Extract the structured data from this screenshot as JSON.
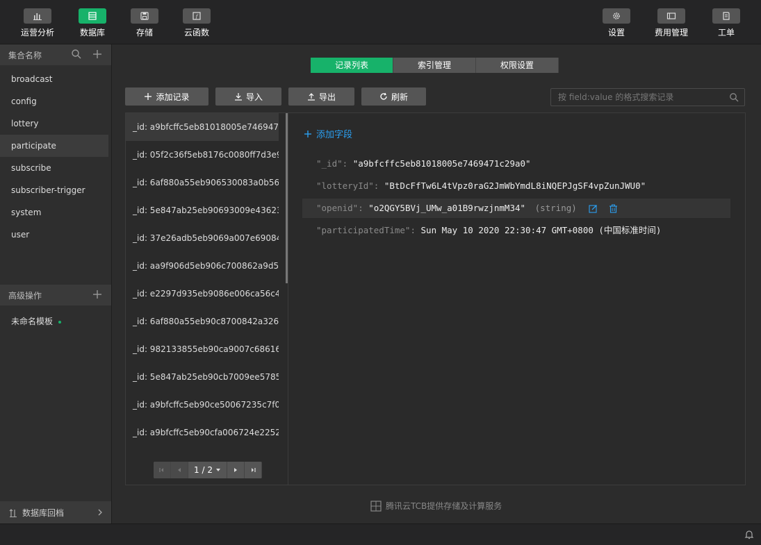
{
  "topbar": {
    "left": [
      {
        "label": "运营分析",
        "icon": "bar-chart-icon"
      },
      {
        "label": "数据库",
        "icon": "database-icon"
      },
      {
        "label": "存储",
        "icon": "storage-icon"
      },
      {
        "label": "云函数",
        "icon": "cloud-function-icon"
      }
    ],
    "right": [
      {
        "label": "设置",
        "icon": "gear-icon"
      },
      {
        "label": "费用管理",
        "icon": "billing-icon"
      },
      {
        "label": "工单",
        "icon": "ticket-icon"
      }
    ]
  },
  "sidebar": {
    "header": "集合名称",
    "collections": [
      "broadcast",
      "config",
      "lottery",
      "participate",
      "subscribe",
      "subscriber-trigger",
      "system",
      "user"
    ],
    "advanced_header": "高级操作",
    "template_item": "未命名模板",
    "backfile": "数据库回档"
  },
  "tabs": [
    "记录列表",
    "索引管理",
    "权限设置"
  ],
  "toolbar": {
    "add": "添加记录",
    "import": "导入",
    "export": "导出",
    "refresh": "刷新"
  },
  "search": {
    "placeholder": "按 field:value 的格式搜索记录"
  },
  "records": [
    "_id: a9bfcffc5eb81018005e746947...",
    "_id: 05f2c36f5eb8176c0080ff7d3e9...",
    "_id: 6af880a55eb906530083a0b56f...",
    "_id: 5e847ab25eb90693009e43623...",
    "_id: 37e26adb5eb9069a007e69084...",
    "_id: aa9f906d5eb906c700862a9d5...",
    "_id: e2297d935eb9086e006ca56c4...",
    "_id: 6af880a55eb90c8700842a3268...",
    "_id: 982133855eb90ca9007c68616...",
    "_id: 5e847ab25eb90cb7009ee5785...",
    "_id: a9bfcffc5eb90ce50067235c7f0...",
    "_id: a9bfcffc5eb90cfa006724e2252..."
  ],
  "pager": {
    "text": "1 / 2"
  },
  "detail": {
    "add_field": "添加字段",
    "fields": [
      {
        "key": "\"_id\":",
        "value": "\"a9bfcffc5eb81018005e7469471c29a0\""
      },
      {
        "key": "\"lotteryId\":",
        "value": "\"BtDcFfTw6L4tVpz0raG2JmWbYmdL8iNQEPJgSF4vpZunJWU0\""
      },
      {
        "key": "\"openid\":",
        "value": "\"o2QGY5BVj_UMw_a01B9rwzjnmM34\"",
        "type": "(string)"
      },
      {
        "key": "\"participatedTime\":",
        "value": "Sun May 10 2020 22:30:47 GMT+0800 (中国标准时间)"
      }
    ]
  },
  "footer": "腾讯云TCB提供存储及计算服务",
  "colors": {
    "accent": "#17b26a",
    "link": "#2b9ff0"
  }
}
